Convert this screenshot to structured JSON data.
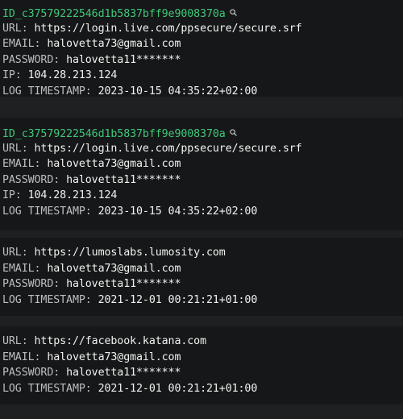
{
  "labels": {
    "url": "URL:",
    "email": "EMAIL:",
    "password": "PASSWORD:",
    "ip": "IP:",
    "log_timestamp": "LOG TIMESTAMP:"
  },
  "records": [
    {
      "id": "ID_c37579222546d1b5837bff9e9008370a",
      "url": "https://login.live.com/ppsecure/secure.srf",
      "email": "halovetta73@gmail.com",
      "password": "halovetta11*******",
      "ip": "104.28.213.124",
      "log_timestamp": "2023-10-15 04:35:22+02:00"
    },
    {
      "id": "ID_c37579222546d1b5837bff9e9008370a",
      "url": "https://login.live.com/ppsecure/secure.srf",
      "email": "halovetta73@gmail.com",
      "password": "halovetta11*******",
      "ip": "104.28.213.124",
      "log_timestamp": "2023-10-15 04:35:22+02:00"
    },
    {
      "url": "https://lumoslabs.lumosity.com",
      "email": "halovetta73@gmail.com",
      "password": "halovetta11*******",
      "log_timestamp": "2021-12-01 00:21:21+01:00"
    },
    {
      "url": "https://facebook.katana.com",
      "email": "halovetta73@gmail.com",
      "password": "halovetta11*******",
      "log_timestamp": "2021-12-01 00:21:21+01:00"
    }
  ],
  "icons": {
    "id_search": "search-icon"
  },
  "colors": {
    "page_background": "#1e2022",
    "card_background": "#161718",
    "id_green": "#3ec87a",
    "label_gray": "#bdbec0",
    "value_white": "#f1f1f1"
  }
}
